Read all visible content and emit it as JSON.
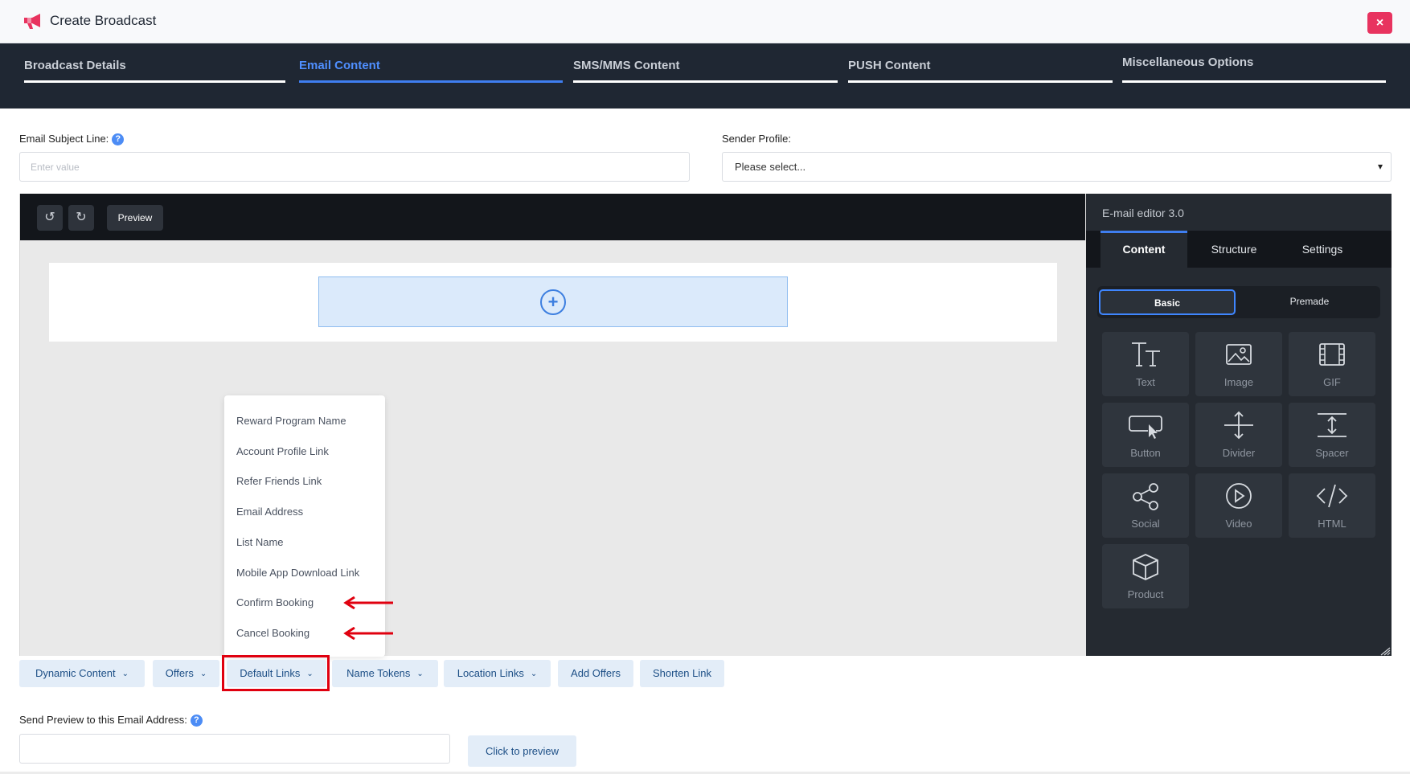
{
  "window": {
    "title": "Create Broadcast",
    "close_icon": "close-icon",
    "close_label": "×",
    "brand_color": "#e8335f"
  },
  "wizard_tabs": [
    {
      "label": "Broadcast Details",
      "active": false
    },
    {
      "label": "Email Content",
      "active": true
    },
    {
      "label": "SMS/MMS Content",
      "active": false
    },
    {
      "label": "PUSH Content",
      "active": false
    },
    {
      "label": "Miscellaneous Options",
      "active": false
    }
  ],
  "form": {
    "subject_label": "Email Subject Line:",
    "subject_placeholder": "Enter value",
    "subject_value": "",
    "help_glyph": "?",
    "sender_label": "Sender Profile:",
    "sender_value": "Please select..."
  },
  "editor": {
    "undo_icon": "undo-icon",
    "redo_icon": "redo-icon",
    "preview_label": "Preview",
    "add_block_icon": "plus-circle-icon",
    "add_block_glyph": "+"
  },
  "dropdown": {
    "items": [
      "Reward Program Name",
      "Account Profile Link",
      "Refer Friends Link",
      "Email Address",
      "List Name",
      "Mobile App Download Link",
      "Confirm Booking",
      "Cancel Booking"
    ],
    "annotated_items": [
      "Confirm Booking",
      "Cancel Booking"
    ],
    "annotation_color": "#e0000f"
  },
  "side_panel": {
    "title": "E-mail editor 3.0",
    "tabs": [
      {
        "label": "Content",
        "active": true
      },
      {
        "label": "Structure",
        "active": false
      },
      {
        "label": "Settings",
        "active": false
      }
    ],
    "segments": [
      {
        "label": "Basic",
        "active": true
      },
      {
        "label": "Premade",
        "active": false
      }
    ],
    "blocks": [
      {
        "label": "Text",
        "icon": "text-icon"
      },
      {
        "label": "Image",
        "icon": "image-icon"
      },
      {
        "label": "GIF",
        "icon": "gif-film-icon"
      },
      {
        "label": "Button",
        "icon": "button-cursor-icon"
      },
      {
        "label": "Divider",
        "icon": "divider-icon"
      },
      {
        "label": "Spacer",
        "icon": "spacer-icon"
      },
      {
        "label": "Social",
        "icon": "share-icon"
      },
      {
        "label": "Video",
        "icon": "play-icon"
      },
      {
        "label": "HTML",
        "icon": "code-icon"
      },
      {
        "label": "Product",
        "icon": "box-icon"
      }
    ]
  },
  "merge_buttons": [
    {
      "label": "Dynamic Content",
      "has_caret": true
    },
    {
      "label": "Offers",
      "has_caret": true
    },
    {
      "label": "Default Links",
      "has_caret": true,
      "highlighted": true
    },
    {
      "label": "Name Tokens",
      "has_caret": true
    },
    {
      "label": "Location Links",
      "has_caret": true
    },
    {
      "label": "Add Offers",
      "has_caret": false
    },
    {
      "label": "Shorten Link",
      "has_caret": false
    }
  ],
  "caret_glyph": "⌄",
  "preview_section": {
    "label": "Send Preview to this Email Address:",
    "email_value": "",
    "button_label": "Click to preview"
  },
  "colors": {
    "accent": "#3f7ef0",
    "dark_header": "#1f2733",
    "panel_bg": "#252a31",
    "chip_bg": "#e3edf8",
    "chip_text": "#1d4f86"
  }
}
